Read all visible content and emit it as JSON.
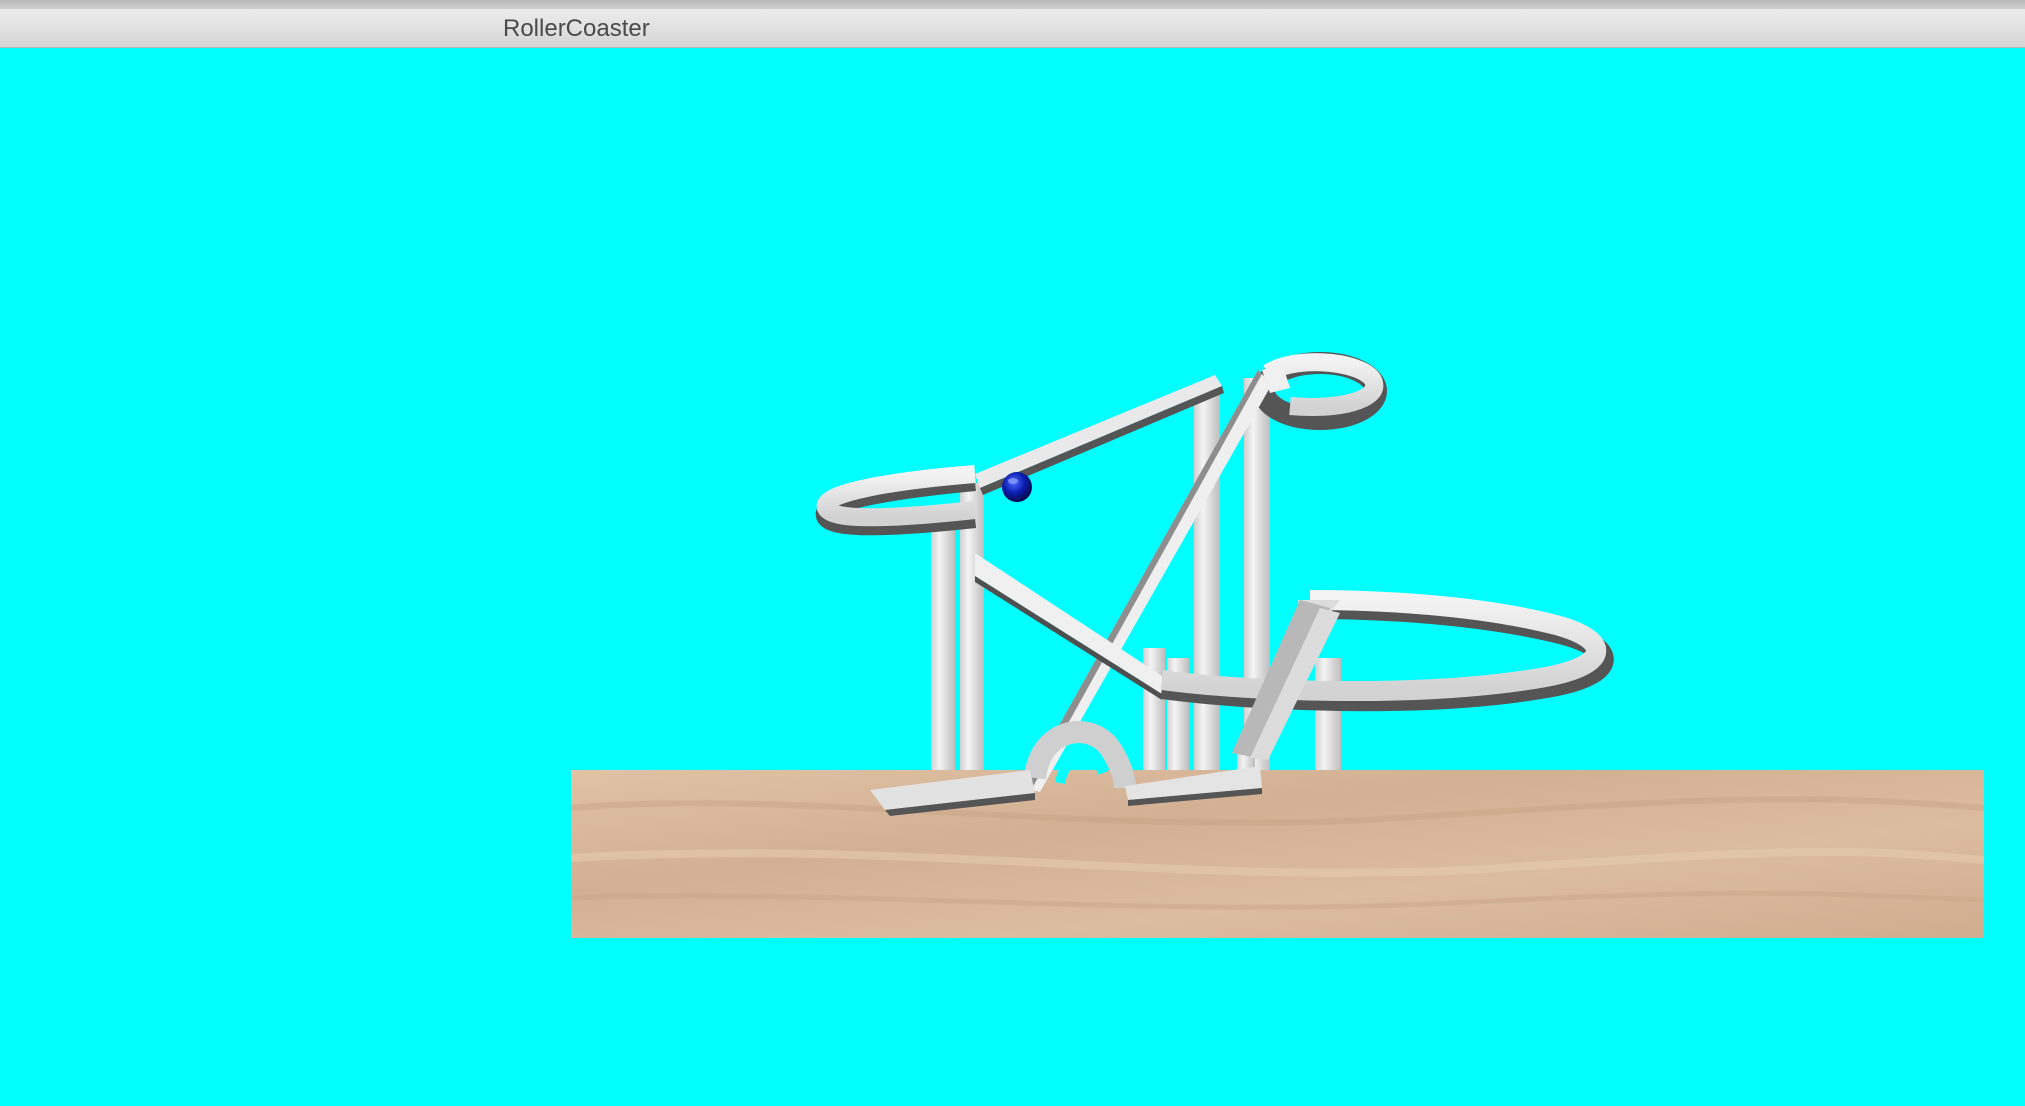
{
  "window": {
    "title": "RollerCoaster"
  },
  "scene": {
    "sky_color": "#00ffff",
    "track_color": "#e6e6e6",
    "track_shadow_color": "#555555",
    "car_color": "#0a1aa8",
    "ground_color": "#d9b89a"
  }
}
